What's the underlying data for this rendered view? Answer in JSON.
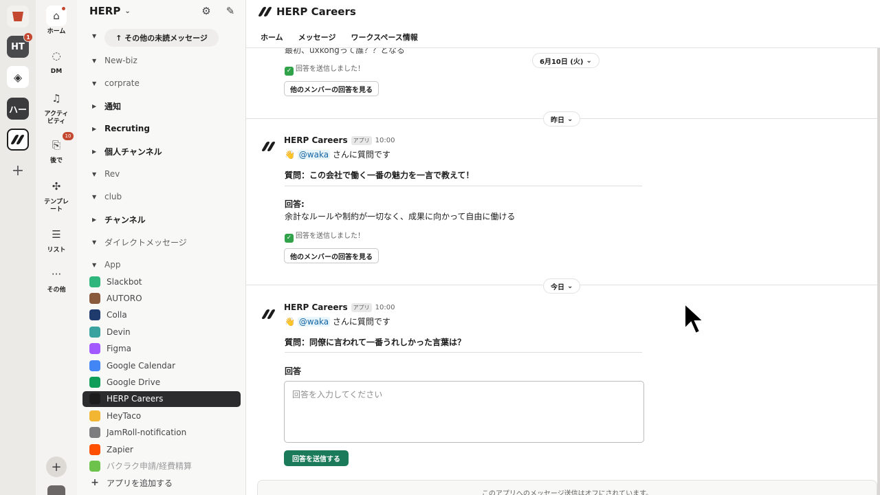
{
  "rail": {
    "badge_ht": "1",
    "ws_ht": "HT",
    "ws_ha": "ハー",
    "add": "+"
  },
  "nav": {
    "home": "ホーム",
    "dm": "DM",
    "activity_line1": "アクティ",
    "activity_line2": "ビティ",
    "later": "後で",
    "later_badge": "10",
    "templates_line1": "テンプレ",
    "templates_line2": "ート",
    "lists": "リスト",
    "more": "その他",
    "more_glyph": "···",
    "plus": "+"
  },
  "sidebar": {
    "workspace": "HERP",
    "unread_button": "↑ その他の未読メッセージ",
    "sections": [
      {
        "label": "New-biz",
        "bold": false
      },
      {
        "label": "corprate",
        "bold": false
      },
      {
        "label": "通知",
        "bold": true
      },
      {
        "label": "Recruting",
        "bold": true
      },
      {
        "label": "個人チャンネル",
        "bold": true
      },
      {
        "label": "Rev",
        "bold": false
      },
      {
        "label": "club",
        "bold": false
      },
      {
        "label": "チャンネル",
        "bold": true
      },
      {
        "label": "ダイレクトメッセージ",
        "bold": false
      },
      {
        "label": "App",
        "bold": false
      }
    ],
    "apps": [
      {
        "label": "Slackbot",
        "color": "#2eb67d"
      },
      {
        "label": "AUTORO",
        "color": "#8a5a3c"
      },
      {
        "label": "Colla",
        "color": "#1f3b6e"
      },
      {
        "label": "Devin",
        "color": "#3aa3a0"
      },
      {
        "label": "Figma",
        "color": "#a259ff"
      },
      {
        "label": "Google Calendar",
        "color": "#4285f4"
      },
      {
        "label": "Google Drive",
        "color": "#0f9d58"
      },
      {
        "label": "HERP Careers",
        "color": "#1d1c1d"
      },
      {
        "label": "HeyTaco",
        "color": "#f2b632"
      },
      {
        "label": "JamRoll-notification",
        "color": "#7d7c7e"
      },
      {
        "label": "Zapier",
        "color": "#ff4f00"
      },
      {
        "label": "バクラク申請/経費精算",
        "color": "#6cc24a"
      },
      {
        "label": "アプリを追加する",
        "color": "#7d7c7e"
      }
    ]
  },
  "header": {
    "title": "HERP Careers",
    "tabs": [
      "ホーム",
      "メッセージ",
      "ワークスペース情報"
    ]
  },
  "messages": {
    "cut_text": "最初、uxkongって誰？？となる",
    "sent_1": "回答を送信しました！",
    "see_others_1": "他のメンバーの回答を見る",
    "date_1": "6月10日 (火)",
    "date_2": "昨日",
    "date_3": "今日",
    "chevron": "⌄",
    "m1": {
      "sender": "HERP Careers",
      "tag": "アプリ",
      "time": "10:00",
      "mention": "@waka",
      "intro": " さんに質問です",
      "question": "質問：この会社で働く一番の魅力を一言で教えて！",
      "answer_label": "回答:",
      "answer": "余計なルールや制約が一切なく、成果に向かって自由に働ける",
      "sent": "回答を送信しました！",
      "see_others": "他のメンバーの回答を見る"
    },
    "m2": {
      "sender": "HERP Careers",
      "tag": "アプリ",
      "time": "10:00",
      "mention": "@waka",
      "intro": " さんに質問です",
      "question": "質問：同僚に言われて一番うれしかった言葉は？",
      "answer_label": "回答",
      "placeholder": "回答を入力してください",
      "submit": "回答を送信する"
    },
    "footer": "このアプリへのメッセージ送信はオフにされています。"
  }
}
